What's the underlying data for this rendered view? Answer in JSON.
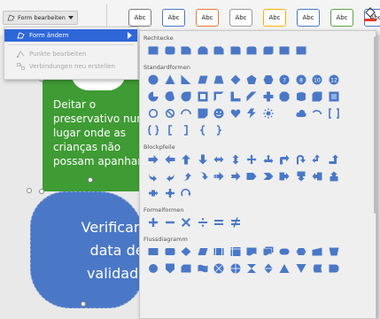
{
  "ribbon": {
    "format_button_label": "Form bearbeiten",
    "style_swatches": [
      {
        "label": "Abc",
        "border": "#7a7a7a"
      },
      {
        "label": "Abc",
        "border": "#4a78c7"
      },
      {
        "label": "Abc",
        "border": "#e07b39"
      },
      {
        "label": "Abc",
        "border": "#9a9a9a"
      },
      {
        "label": "Abc",
        "border": "#f0b400"
      },
      {
        "label": "Abc",
        "border": "#4a78c7"
      },
      {
        "label": "Abc",
        "border": "#5aa34a"
      },
      {
        "label": "Abc",
        "border": "#4a78c7"
      }
    ]
  },
  "menu": {
    "change_shape": "Form ändern",
    "edit_points": "Punkte bearbeiten",
    "reroute_connections": "Verbindungen neu erstellen"
  },
  "shapes_menu": {
    "sections": [
      {
        "title": "Rechtecke",
        "rows": [
          [
            "rect",
            "round-rect",
            "snip1",
            "snip2",
            "snip-round",
            "round1",
            "round2",
            "round-diag",
            "rect",
            "rect"
          ]
        ]
      },
      {
        "title": "Standardformen",
        "rows": [
          [
            "circle",
            "triangle",
            "right-triangle",
            "parallelogram",
            "trapezoid",
            "diamond",
            "pentagon",
            "hexagon",
            "7",
            "8",
            "10",
            "12"
          ],
          [
            "pie",
            "chord",
            "teardrop",
            "frame",
            "half-frame",
            "L",
            "diag-stripe",
            "plus",
            "octagon",
            "can",
            "cube",
            "bevel"
          ],
          [
            "donut",
            "no-symbol",
            "block-arc",
            "folded",
            "smiley",
            "heart",
            "lightning",
            "sun",
            "moon",
            "cloud",
            "arc",
            "double-bracket"
          ],
          [
            "double-brace",
            "bracket-l",
            "bracket-r",
            "brace-l",
            "brace-r"
          ]
        ]
      },
      {
        "title": "Blockpfeile",
        "rows": [
          [
            "arrow-right",
            "arrow-left",
            "arrow-up",
            "arrow-down",
            "arrow-lr",
            "arrow-ud",
            "quad",
            "lr-up",
            "bent",
            "u-turn",
            "left-up",
            "bent-up"
          ],
          [
            "curved-r",
            "curved-l",
            "curved-u",
            "curved-d",
            "striped",
            "notched",
            "pentagon-arrow",
            "chevron",
            "callout-r",
            "callout-d",
            "callout-l",
            "callout-u"
          ],
          [
            "callout-lr",
            "callout-quad",
            "circular"
          ]
        ]
      },
      {
        "title": "Formelformen",
        "rows": [
          [
            "plus-eq",
            "minus",
            "multiply",
            "divide",
            "equal",
            "not-equal"
          ]
        ]
      },
      {
        "title": "Flussdiagramm",
        "rows": [
          [
            "process",
            "alt-process",
            "decision",
            "data",
            "predefined",
            "internal",
            "document",
            "multidoc",
            "terminator",
            "preparation",
            "manual-input",
            "manual-op"
          ],
          [
            "connector",
            "offpage",
            "card",
            "punched",
            "sum",
            "or",
            "collate",
            "sort",
            "extract",
            "merge",
            "stored",
            "delay"
          ]
        ]
      }
    ],
    "shape_color": "#4a78c7"
  },
  "canvas": {
    "green_shape_text": "Deitar o preservativo num lugar onde as crianças não possam apanhar",
    "blue_shape_text": "Verificar a data de validade",
    "green_color": "#3f9b34",
    "blue_color": "#4a78c7"
  }
}
